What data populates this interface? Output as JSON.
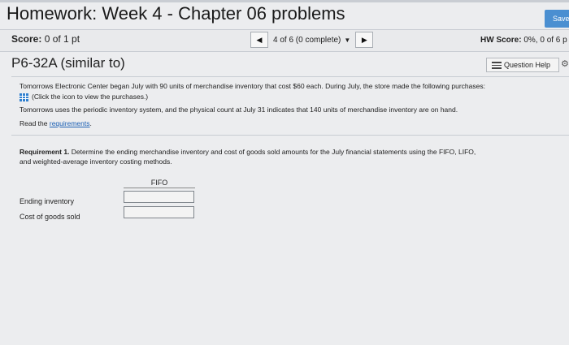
{
  "header": {
    "title": "Homework: Week 4 - Chapter 06 problems",
    "save_label": "Save"
  },
  "scorebar": {
    "score_label": "Score:",
    "score_value": "0 of 1 pt",
    "nav_label": "4 of 6 (0 complete)",
    "hw_score_label": "HW Score:",
    "hw_score_value": "0%, 0 of 6 p"
  },
  "problem": {
    "title": "P6-32A (similar to)",
    "help_label": "Question Help"
  },
  "content": {
    "line1": "Tomorrows Electronic Center began July with 90 units of merchandise inventory that cost $60 each. During July, the store made the following purchases:",
    "line2": "(Click the icon to view the purchases.)",
    "line3": "Tomorrows uses the periodic inventory system, and the physical count at July 31 indicates that 140 units of merchandise inventory are on hand.",
    "line4_prefix": "Read the",
    "line4_link": "requirements",
    "line4_suffix": ".",
    "req_bold": "Requirement 1.",
    "req_text": " Determine the ending merchandise inventory and cost of goods sold amounts for the July financial statements using the FIFO, LIFO,",
    "req_text2": "and weighted-average inventory costing methods."
  },
  "table": {
    "column_header": "FIFO",
    "rows": [
      {
        "label": "Ending inventory",
        "value": ""
      },
      {
        "label": "Cost of goods sold",
        "value": ""
      }
    ]
  }
}
